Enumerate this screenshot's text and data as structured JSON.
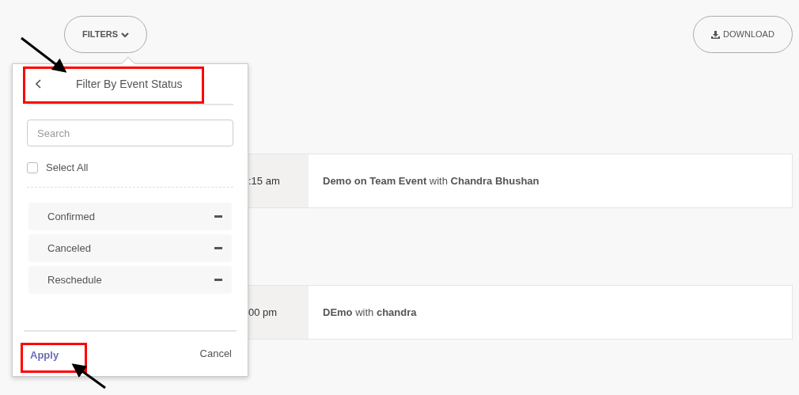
{
  "toolbar": {
    "filters_button": "FILTERS",
    "download_button": "DOWNLOAD"
  },
  "events": [
    {
      "time": ":15 am",
      "title": "**Demo on Team Event** with **Chandra Bhushan**"
    },
    {
      "time": "00 pm",
      "title": "**DEmo** with **chandra**"
    }
  ],
  "filter_popup": {
    "title": "Filter By Event Status",
    "search": {
      "placeholder": "Search"
    },
    "select_all": {
      "label": "Select All",
      "checked": false
    },
    "statuses": [
      {
        "label": "Confirmed"
      },
      {
        "label": "Canceled"
      },
      {
        "label": "Reschedule"
      }
    ],
    "apply_button": "Apply",
    "cancel_button": "Cancel"
  }
}
